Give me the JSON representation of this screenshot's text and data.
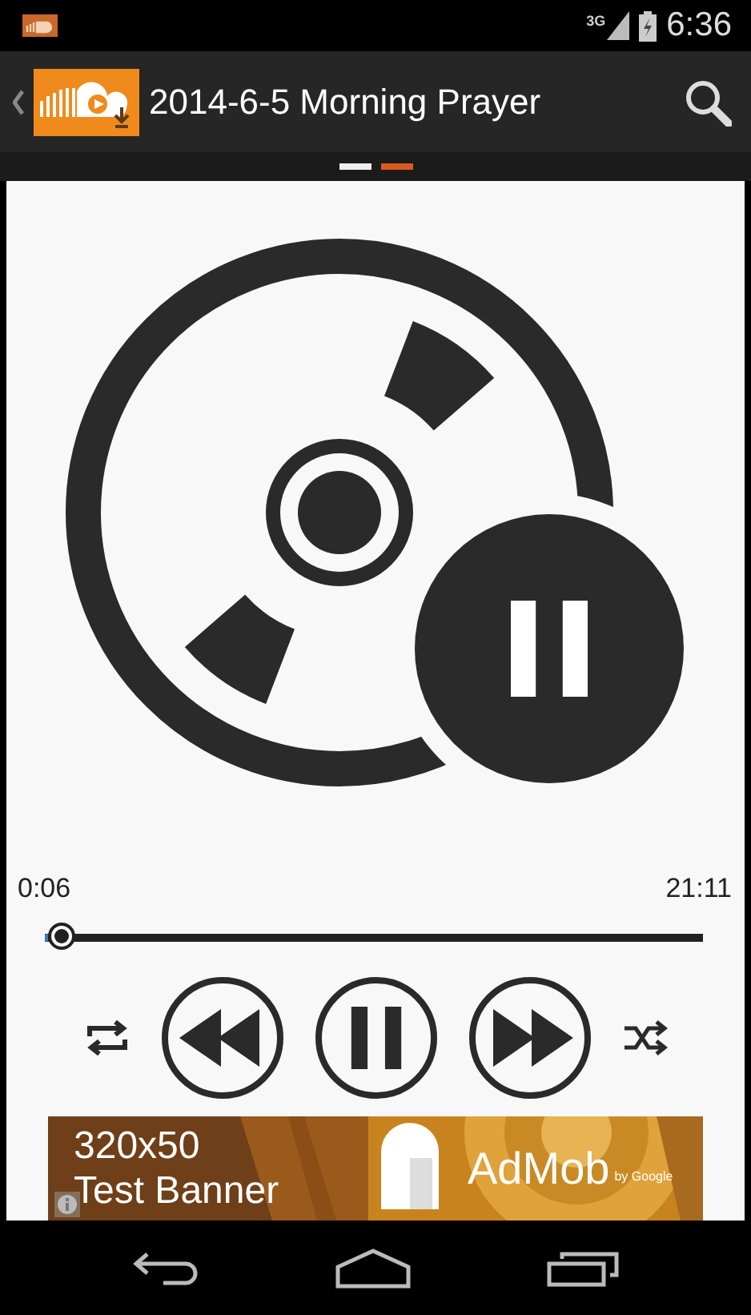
{
  "status_bar": {
    "network": "3G",
    "time": "6:36"
  },
  "action_bar": {
    "title": "2014-6-5 Morning Prayer"
  },
  "pager": [
    {
      "selected": false
    },
    {
      "selected": true
    }
  ],
  "player": {
    "playing": true,
    "elapsed": "0:06",
    "duration": "21:11",
    "level": 0.006
  },
  "ad": {
    "kind": "picture",
    "headline": "320x50",
    "subline": "Test Banner",
    "brand": "AdMob",
    "byline": "by Google"
  }
}
